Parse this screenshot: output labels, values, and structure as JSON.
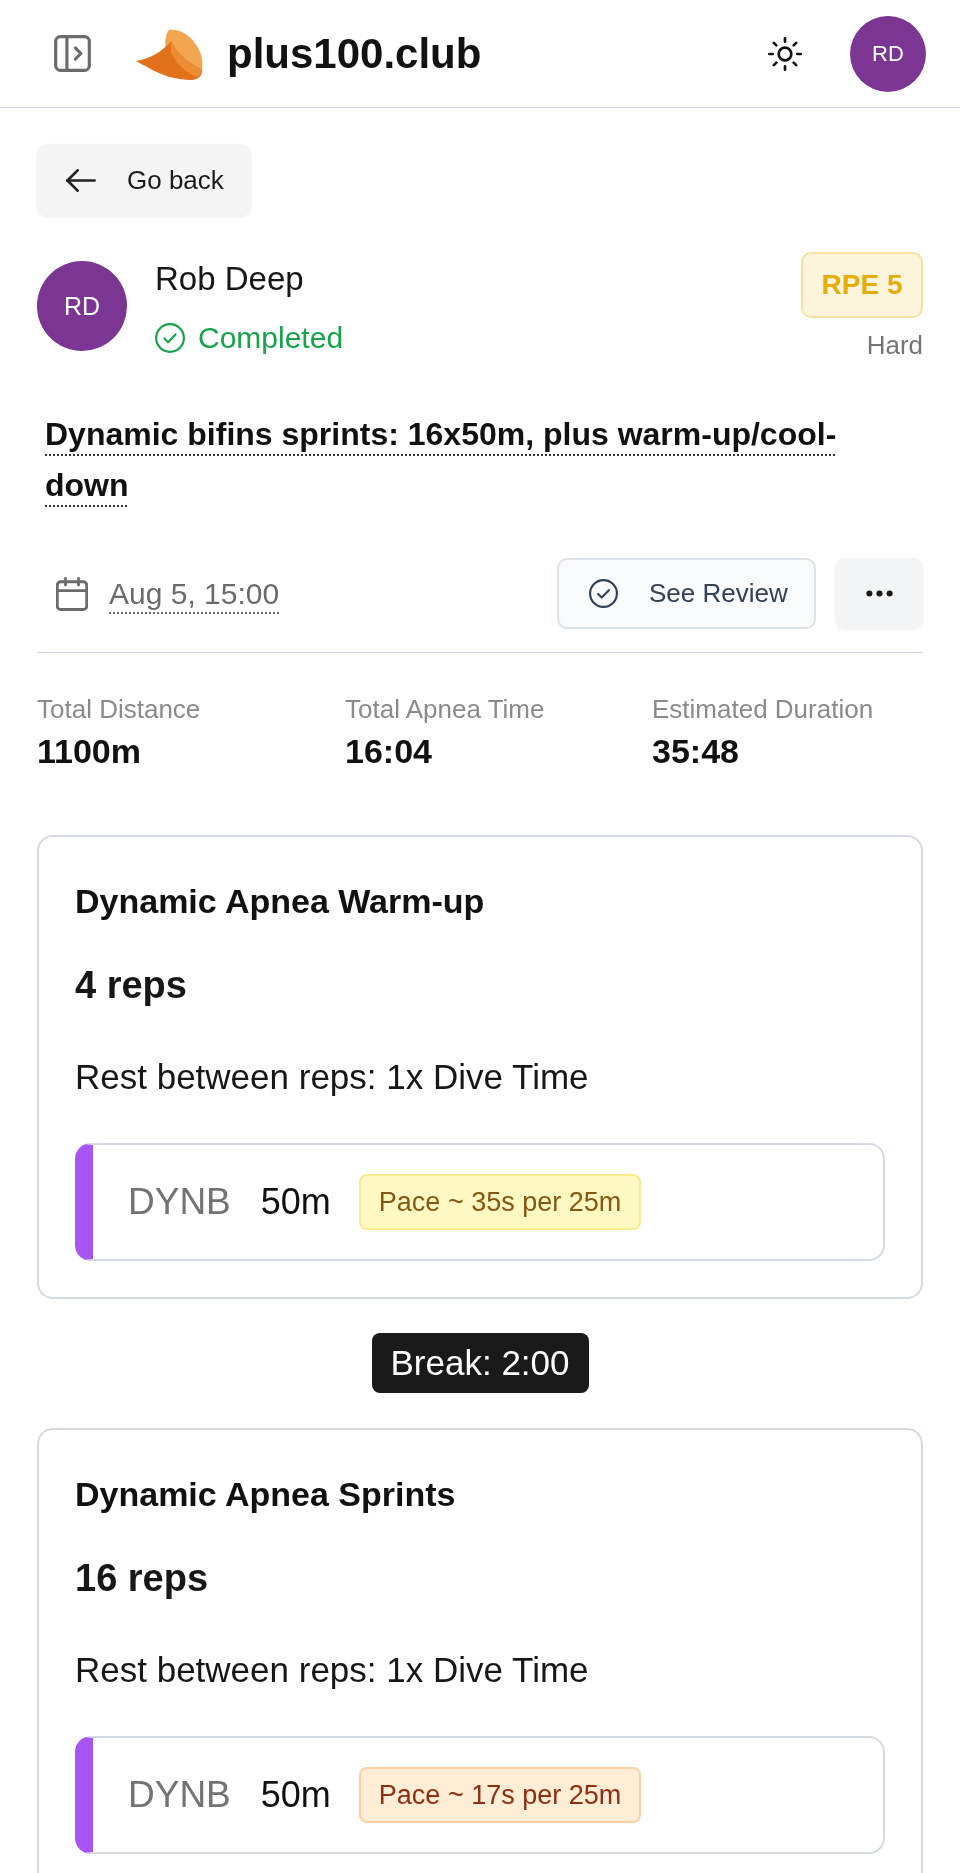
{
  "header": {
    "brand": "plus100.club",
    "avatar": "RD"
  },
  "back_button": {
    "label": "Go back"
  },
  "athlete": {
    "initials": "RD",
    "name": "Rob Deep",
    "status": "Completed",
    "rpe": "RPE 5",
    "rpe_caption": "Hard"
  },
  "session": {
    "title": "Dynamic bifins sprints: 16x50m, plus warm-up/cool-down",
    "date": "Aug 5, 15:00"
  },
  "actions": [
    {
      "kind": "review",
      "label": "See Review"
    },
    {
      "kind": "more"
    }
  ],
  "stats": [
    {
      "label": "Total Distance",
      "value": "1100m"
    },
    {
      "label": "Total Apnea Time",
      "value": "16:04"
    },
    {
      "label": "Estimated Duration",
      "value": "35:48"
    }
  ],
  "blocks": [
    {
      "kind": "set",
      "title": "Dynamic Apnea Warm-up",
      "reps": "4 reps",
      "rest": "Rest between reps: 1x Dive Time",
      "intervals": [
        {
          "discipline": "DYNB",
          "distance": "50m",
          "pace": "Pace ~ 35s per 25m",
          "color": "#fef9c3"
        }
      ]
    },
    {
      "kind": "break",
      "label": "Break: 2:00"
    },
    {
      "kind": "set",
      "title": "Dynamic Apnea Sprints",
      "reps": "16 reps",
      "rest": "Rest between reps: 1x Dive Time",
      "intervals": [
        {
          "discipline": "DYNB",
          "distance": "50m",
          "pace": "Pace ~ 17s per 25m",
          "color": "#ffedd5"
        }
      ]
    }
  ]
}
